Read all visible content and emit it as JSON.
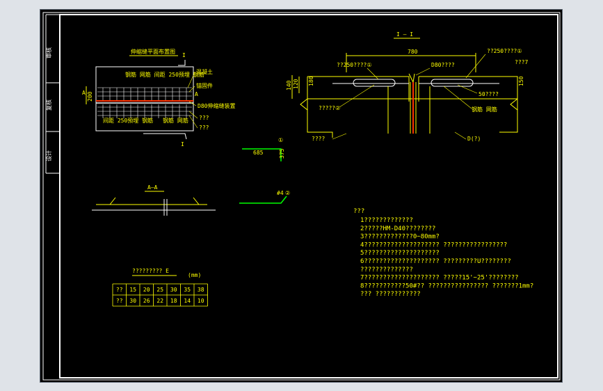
{
  "side_labels": [
    "审核",
    "复核",
    "设计"
  ],
  "plan_view": {
    "title": "伸缩缝平面布置图",
    "top_label": "I",
    "bottom_label": "I",
    "section_mark": "A",
    "dim_left": "200",
    "labels": {
      "upper_rebar": "钢筋 网筋 间距 250预埋 钢筋",
      "concrete": "混凝土",
      "anchor": "锚固件",
      "device": "D80伸缩缝装置",
      "lower_rebar": "间距 250预埋 钢筋",
      "lower_right": "钢筋 网筋",
      "q1": "???",
      "q2": "???"
    }
  },
  "section_view": {
    "title": "I — I",
    "dim_top": "780",
    "dim_left1": "140",
    "dim_left2": "120",
    "dim_left3": "180",
    "dim_right": "150",
    "labels": {
      "left_rebar": "??250????①",
      "right_rebar": "??250????①",
      "device": "D80????",
      "right_top": "???7",
      "mid_right": "50????",
      "left_mid": "?????②",
      "right_mid": "钢筋 网筋",
      "left_bottom": "????",
      "right_bottom": "D(?)"
    }
  },
  "detail_1": {
    "mark": "①",
    "dim_h": "685",
    "dim_v": "375"
  },
  "detail_2": {
    "mark": "②",
    "label": "#4"
  },
  "aa_view": {
    "title": "A—A"
  },
  "table": {
    "title": "????????? E",
    "unit": "(mm)",
    "rows": [
      [
        "??",
        "15",
        "20",
        "25",
        "30",
        "35",
        "38"
      ],
      [
        "??",
        "30",
        "26",
        "22",
        "18",
        "14",
        "10"
      ]
    ]
  },
  "notes": {
    "heading": "???",
    "lines": [
      "1?????????????",
      "2?????HM-D40????????",
      "3?????????????0~80mm?",
      "4????????????????????    ?????????????????",
      "5????????????????????",
      "6????????????????????    ?????????U????????",
      "   ??????????????",
      "7????????????????????    ?????15'~25'????????",
      "8???????????50#??  ????????????????    ???????1mm?",
      "   ??? ????????????"
    ]
  },
  "colors": {
    "line": "#ffff00",
    "frame": "#ffffff",
    "accent": "#ff3300",
    "green": "#00ff00",
    "background": "#000000"
  }
}
